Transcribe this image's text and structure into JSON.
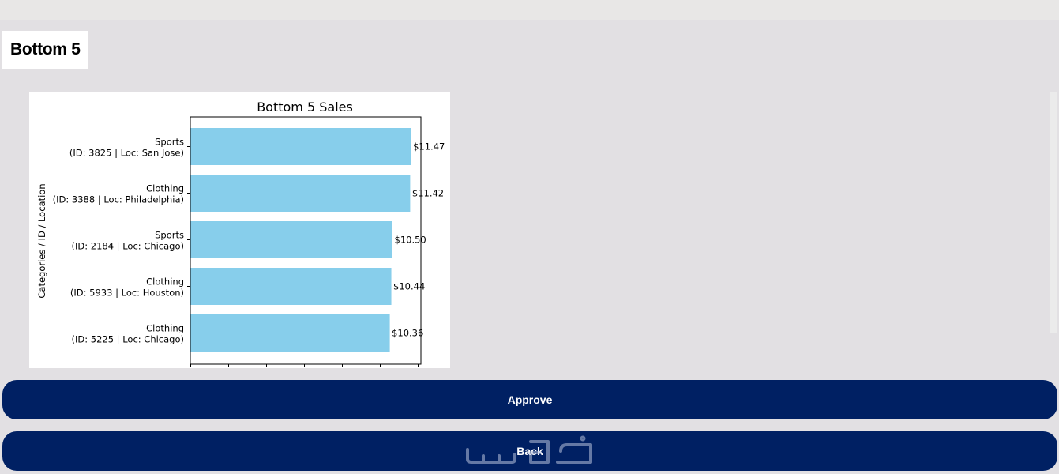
{
  "section": {
    "title": "Bottom 5"
  },
  "chart_data": {
    "type": "bar",
    "orientation": "horizontal",
    "title": "Bottom 5 Sales",
    "ylabel": "Categories / ID / Location",
    "xlabel": "",
    "categories": [
      {
        "line1": "Sports",
        "line2": "(ID: 3825 | Loc: San Jose)"
      },
      {
        "line1": "Clothing",
        "line2": "(ID: 3388 | Loc: Philadelphia)"
      },
      {
        "line1": "Sports",
        "line2": "(ID: 2184 | Loc: Chicago)"
      },
      {
        "line1": "Clothing",
        "line2": "(ID: 5933 | Loc: Houston)"
      },
      {
        "line1": "Clothing",
        "line2": "(ID: 5225 | Loc: Chicago)"
      }
    ],
    "values": [
      11.47,
      11.42,
      10.5,
      10.44,
      10.36
    ],
    "value_labels": [
      "$11.47",
      "$11.42",
      "$10.50",
      "$10.44",
      "$10.36"
    ],
    "xlim": [
      0,
      12
    ],
    "bar_color": "#87ceeb",
    "grid": false
  },
  "actions": {
    "approve_label": "Approve",
    "back_label": "Back"
  },
  "colors": {
    "button": "#002063",
    "background": "#e2e0e3"
  }
}
